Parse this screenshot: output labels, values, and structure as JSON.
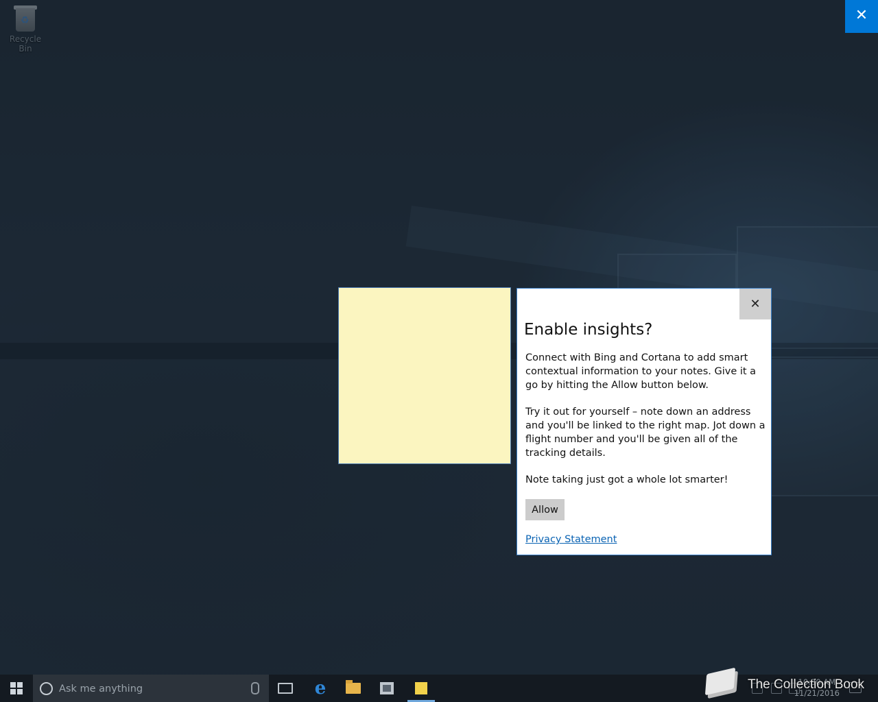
{
  "desktop": {
    "recycle_bin_label": "Recycle Bin"
  },
  "overlay": {
    "close_symbol": "✕"
  },
  "dialog": {
    "close_symbol": "✕",
    "title": "Enable insights?",
    "paragraphs": [
      "Connect with Bing and Cortana to add smart contextual information to your notes. Give it a go by hitting the Allow button below.",
      "Try it out for yourself – note down an address and you'll be linked to the right map. Jot down a flight number and you'll be given all of the tracking details.",
      "Note taking just got a whole lot smarter!"
    ],
    "allow_label": "Allow",
    "privacy_link": "Privacy Statement"
  },
  "taskbar": {
    "search_placeholder": "Ask me anything",
    "clock_time": "10:30 AM",
    "clock_date": "11/21/2016",
    "icons": [
      "windows-start-icon",
      "cortana-circle-icon",
      "microphone-icon",
      "task-view-icon",
      "edge-icon",
      "file-explorer-icon",
      "store-icon",
      "sticky-notes-icon"
    ]
  },
  "watermark": {
    "text": "The Collection Book"
  },
  "colors": {
    "accent": "#0078d7",
    "note_yellow": "#fbf5c0",
    "link": "#0a63b3"
  }
}
